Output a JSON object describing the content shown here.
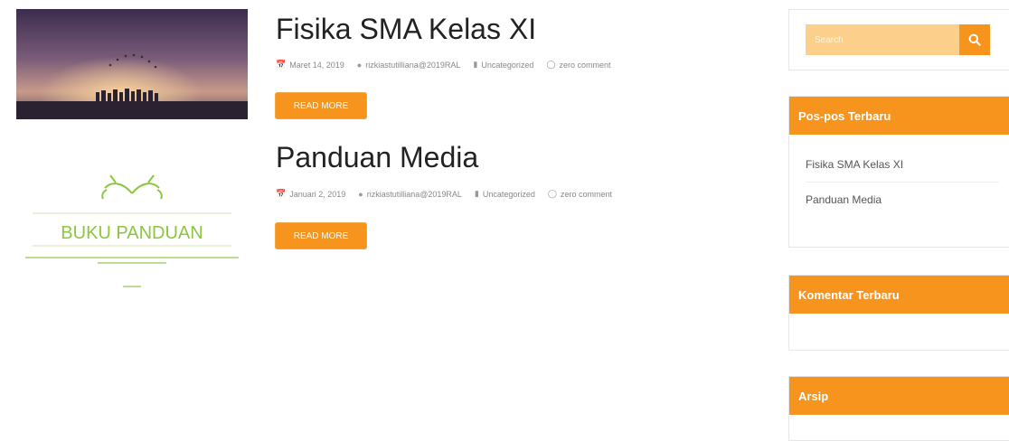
{
  "posts": [
    {
      "title": "Fisika SMA Kelas XI",
      "date": "Maret 14, 2019",
      "author": "rizkiastutilliana@2019RAL",
      "category": "Uncategorized",
      "comments": "zero comment",
      "read_more": "READ MORE"
    },
    {
      "title": "Panduan Media",
      "date": "Januari 2, 2019",
      "author": "rizkiastutilliana@2019RAL",
      "category": "Uncategorized",
      "comments": "zero comment",
      "read_more": "READ MORE",
      "thumb_text": "BUKU PANDUAN"
    }
  ],
  "sidebar": {
    "search": {
      "placeholder": "Search"
    },
    "recent_posts": {
      "title": "Pos-pos Terbaru",
      "items": [
        "Fisika SMA Kelas XI",
        "Panduan Media"
      ]
    },
    "recent_comments": {
      "title": "Komentar Terbaru"
    },
    "archives": {
      "title": "Arsip"
    }
  },
  "colors": {
    "accent": "#f7941d",
    "search_field": "#fcd08a",
    "thumb_green": "#8cc63f"
  },
  "icons": [
    "calendar-icon",
    "user-icon",
    "folder-icon",
    "comment-icon",
    "search-icon"
  ]
}
